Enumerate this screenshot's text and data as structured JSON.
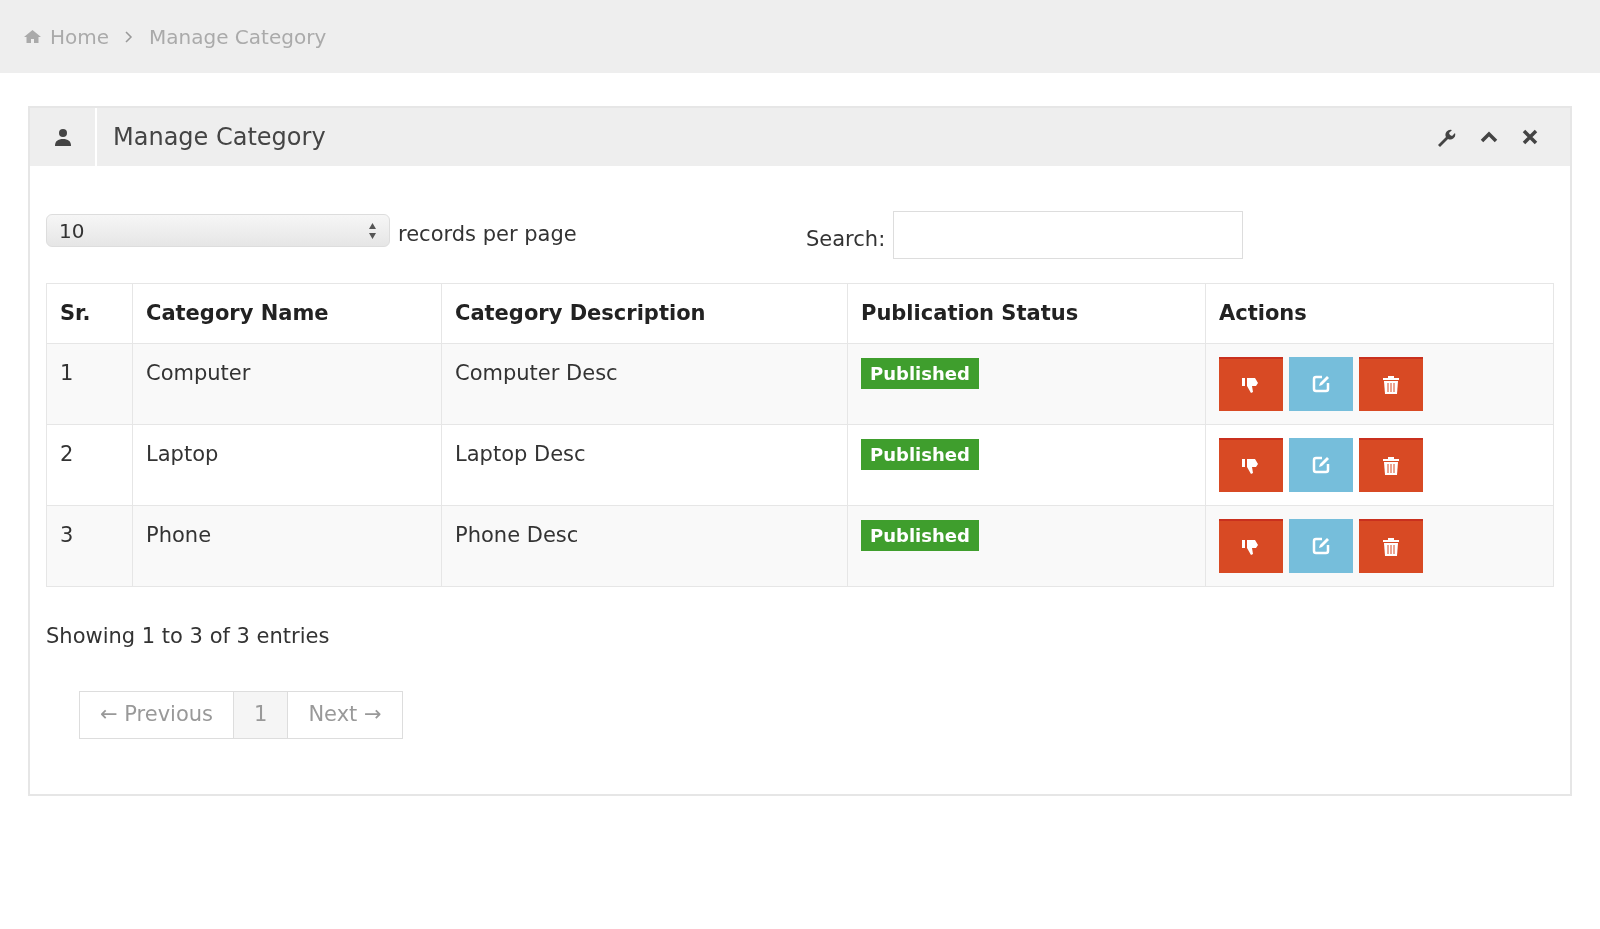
{
  "breadcrumb": [
    {
      "label": "Home",
      "kind": "home"
    },
    {
      "label": "Manage Category",
      "kind": "page"
    }
  ],
  "panel": {
    "title": "Manage Category"
  },
  "length_select": {
    "value": "10",
    "label": "records per page"
  },
  "search": {
    "label": "Search:"
  },
  "table": {
    "columns": [
      "Sr.",
      "Category Name",
      "Category Description",
      "Publication Status",
      "Actions"
    ],
    "rows": [
      {
        "sr": "1",
        "name": "Computer",
        "description": "Computer Desc",
        "status": {
          "label": "Published",
          "kind": "published"
        }
      },
      {
        "sr": "2",
        "name": "Laptop",
        "description": "Laptop Desc",
        "status": {
          "label": "Published",
          "kind": "published"
        }
      },
      {
        "sr": "3",
        "name": "Phone",
        "description": "Phone Desc",
        "status": {
          "label": "Published",
          "kind": "published"
        }
      }
    ]
  },
  "info": "Showing 1 to 3 of 3 entries",
  "pagination": {
    "previous": {
      "label": "← Previous",
      "disabled": true
    },
    "pages": [
      {
        "label": "1",
        "selected": true
      }
    ],
    "next": {
      "label": "Next →",
      "disabled": true
    }
  }
}
